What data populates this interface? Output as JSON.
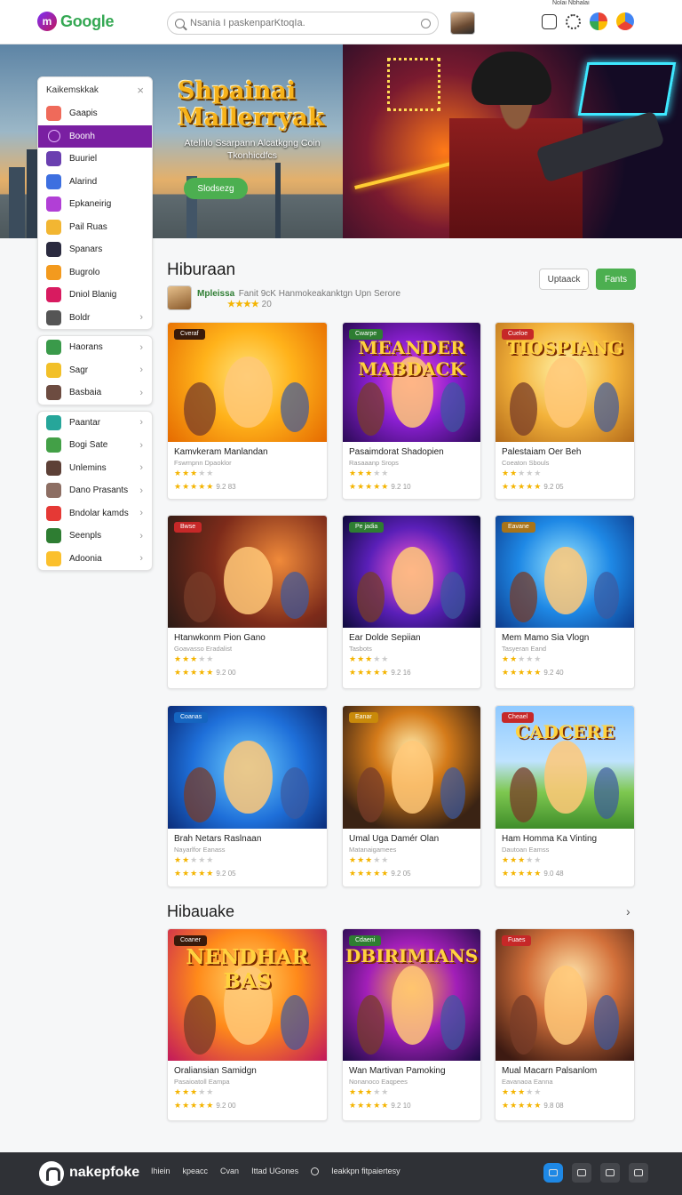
{
  "topbar": {
    "brand": "Google",
    "brand_initial": "m",
    "search_placeholder": "Nsania I paskenparKtoqIa.",
    "tiny_text": "Nolai  Nbhalai"
  },
  "hero": {
    "title_line1": "Shpainai",
    "title_line2": "Mallerryak",
    "subtitle": "Atelnlo Ssarpann Alcatkgng Coin Tkonhicdfcs",
    "button": "Slodsezg"
  },
  "drawer": {
    "header": "Kaikemskkak",
    "close": "×",
    "group1": [
      {
        "label": "Gaapis",
        "color": "#ef6a5a"
      },
      {
        "label": "Boonh",
        "color": "#7a1fa2"
      },
      {
        "label": "Buuriel",
        "color": "#6a3fb0"
      },
      {
        "label": "Alarind",
        "color": "#3d6fe0"
      },
      {
        "label": "Epkaneirig",
        "color": "#b13fd6"
      },
      {
        "label": "Pail Ruas",
        "color": "#f2b632"
      },
      {
        "label": "Spanars",
        "color": "#2b2b40"
      },
      {
        "label": "Bugrolo",
        "color": "#f39a1e"
      },
      {
        "label": "Dniol Blanig",
        "color": "#d81b60"
      },
      {
        "label": "Boldr",
        "color": "#555555"
      }
    ],
    "group2": [
      {
        "label": "Haorans",
        "color": "#3a9a4a"
      },
      {
        "label": "Sagr",
        "color": "#f2c029"
      },
      {
        "label": "Basbaia",
        "color": "#6d4c41"
      }
    ],
    "group3": [
      {
        "label": "Paantar",
        "color": "#26a69a"
      },
      {
        "label": "Bogi Sate",
        "color": "#43a047"
      },
      {
        "label": "Unlemins",
        "color": "#5d4037"
      },
      {
        "label": "Dano Prasants",
        "color": "#8d6e63"
      },
      {
        "label": "Bndolar kamds",
        "color": "#e53935"
      },
      {
        "label": "Seenpls",
        "color": "#2e7d32"
      },
      {
        "label": "Adoonia",
        "color": "#fbc02d"
      }
    ]
  },
  "section1": {
    "title": "Hiburaan",
    "dev_name": "Mpleissa",
    "dev_text": "Fanit 9cK Hanmokeakanktgn Upn Serore",
    "dev_stars": "★★★★",
    "dev_rating": "20",
    "btn_outline": "Uptaack",
    "btn_green": "Fants"
  },
  "cards": [
    {
      "title": "Kamvkeram Manlandan",
      "dev": "Fswmpnn Dpaoklor",
      "badge": "Cveraf",
      "badge_color": "#3a1a0a",
      "art_text": "",
      "rating": "9.2 83",
      "bg": "radial-gradient(circle at 50% 45%, #ffe37a 0%, #ffb21a 45%, #e56a00 100%)"
    },
    {
      "title": "Pasaimdorat Shadopien",
      "dev": "Rasaaanp Srops",
      "badge": "Cwarpe",
      "badge_color": "#2e7d32",
      "art_text": "MEANDER MABDACK",
      "rating": "9.2 10",
      "bg": "radial-gradient(circle at 50% 50%, #ff4fd8 0%, #8a1fd1 45%, #2a0a55 100%)"
    },
    {
      "title": "Palestaiam Oer Beh",
      "dev": "Coeaton Sbouls",
      "badge": "Cueloe",
      "badge_color": "#c62828",
      "art_text": "TIOSPIANG",
      "rating": "9.2 05",
      "bg": "radial-gradient(circle at 50% 40%, #fff2a8 0%, #f3b23a 50%, #b36a1a 100%)"
    },
    {
      "title": "Htanwkonm Pion Gano",
      "dev": "Goavasso Eradalist",
      "badge": "Bwse",
      "badge_color": "#c62828",
      "art_text": "",
      "rating": "9.2 00",
      "bg": "radial-gradient(circle at 70% 40%, #f08a3a 0%, #7d2b1a 50%, #2b1b16 100%)"
    },
    {
      "title": "Ear Dolde Sepiian",
      "dev": "Tasbots",
      "badge": "Pe jadia",
      "badge_color": "#2e7d32",
      "art_text": "",
      "rating": "9.2 16",
      "bg": "radial-gradient(circle at 50% 50%, #ff5bd6 0%, #5a1fb8 50%, #0d0a3a 100%)"
    },
    {
      "title": "Mem Mamo Sia Vlogn",
      "dev": "Tasyeran Eand",
      "badge": "Eavane",
      "badge_color": "#a8741a",
      "art_text": "",
      "rating": "9.2 40",
      "bg": "radial-gradient(circle at 50% 45%, #9ae6ff 0%, #1e88e5 50%, #0d3b8c 100%)"
    },
    {
      "title": "Brah Netars Raslnaan",
      "dev": "Nayarlfor Eanass",
      "badge": "Coanas",
      "badge_color": "#1565c0",
      "art_text": "",
      "rating": "9.2 05",
      "bg": "radial-gradient(circle at 50% 50%, #6fd0ff 0%, #1e6fd9 55%, #0b2d7a 100%)"
    },
    {
      "title": "Umal Uga Damér Olan",
      "dev": "Matanaigamees",
      "badge": "Eanar",
      "badge_color": "#c98a0a",
      "art_text": "",
      "rating": "9.2 05",
      "bg": "radial-gradient(circle at 50% 35%, #ffe9a8 0%, #d47b1a 35%, #3a2314 80%)"
    },
    {
      "title": "Ham Homma Ka Vinting",
      "dev": "Dautoan Eamss",
      "badge": "Cheael",
      "badge_color": "#c62828",
      "art_text": "CADCERE",
      "rating": "9.0 48",
      "bg": "linear-gradient(180deg, #8fc9ff 0%, #bfe3ff 45%, #7ec850 70%, #3f8d2a 100%)"
    }
  ],
  "section2": {
    "title": "Hibauake",
    "chevron": "›"
  },
  "cards2": [
    {
      "title": "Oraliansian Samidgn",
      "dev": "Pasaioatoll Eampa",
      "badge": "Coaner",
      "badge_color": "#3a1a0a",
      "art_text": "NENDHAR BAS",
      "rating": "9.2 00",
      "bg": "radial-gradient(circle at 50% 40%, #ffd86b 0%, #ff8a1a 45%, #c2185b 100%)"
    },
    {
      "title": "Wan Martivan Pamoking",
      "dev": "Nonanoco Eaqpees",
      "badge": "Cdaeni",
      "badge_color": "#2e7d32",
      "art_text": "DBIRIMIANS",
      "rating": "9.2 10",
      "bg": "radial-gradient(circle at 50% 45%, #ffb43a 0%, #a21fb8 45%, #1b0a44 100%)"
    },
    {
      "title": "Mual Macarn Palsanlom",
      "dev": "Eavanaoa Eanna",
      "badge": "Fuaes",
      "badge_color": "#c62828",
      "art_text": "",
      "rating": "9.8 08",
      "bg": "radial-gradient(circle at 55% 35%, #ffe2a8 0%, #d2703a 40%, #3d1a12 90%)"
    }
  ],
  "taskbar": {
    "name": "nakepfoke",
    "links": [
      "Ihiein",
      "kpeacc",
      "Cvan",
      "Ittad UGones"
    ],
    "search_text": "Ieakkpn fitpaiertesy"
  }
}
